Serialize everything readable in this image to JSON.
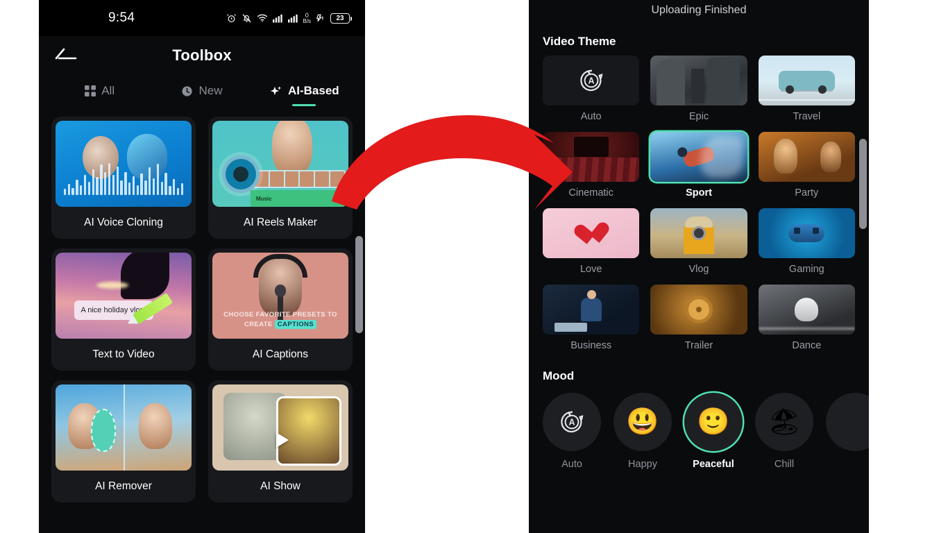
{
  "left_phone": {
    "status_bar": {
      "time": "9:54",
      "network_speed_value": "0",
      "network_speed_unit": "B/s",
      "battery_level": "23",
      "icons": [
        "alarm-icon",
        "bell-muted-icon",
        "wifi-icon",
        "signal-bars-icon",
        "signal-bars-2-icon",
        "network-speed-icon",
        "charging-icon",
        "battery-icon"
      ]
    },
    "header": {
      "title": "Toolbox",
      "back_icon": "back-arrow-icon"
    },
    "tabs": [
      {
        "label": "All",
        "icon": "grid-icon",
        "active": false
      },
      {
        "label": "New",
        "icon": "clock-icon",
        "active": false
      },
      {
        "label": "AI-Based",
        "icon": "sparkle-icon",
        "active": true
      }
    ],
    "tools": [
      {
        "name": "AI Voice Cloning",
        "thumb": "voice-cloning-thumb"
      },
      {
        "name": "AI Reels Maker",
        "thumb": "reels-maker-thumb",
        "overlay_label": "Music"
      },
      {
        "name": "Text to Video",
        "thumb": "text-to-video-thumb",
        "overlay_text": "A nice holiday vlog|"
      },
      {
        "name": "AI Captions",
        "thumb": "ai-captions-thumb",
        "overlay_line1": "CHOOSE  FAVORITE PRESETS TO",
        "overlay_line2": "CREATE ",
        "overlay_highlight": "CAPTIONS"
      },
      {
        "name": "AI Remover",
        "thumb": "ai-remover-thumb"
      },
      {
        "name": "AI Show",
        "thumb": "ai-show-thumb"
      }
    ]
  },
  "right_phone": {
    "upload_status": "Uploading Finished",
    "video_theme": {
      "title": "Video Theme",
      "items": [
        {
          "label": "Auto",
          "icon": "auto-circle-icon",
          "selected": false,
          "art": "auto"
        },
        {
          "label": "Epic",
          "icon": "epic-thumb",
          "selected": false,
          "art": "epic"
        },
        {
          "label": "Travel",
          "icon": "travel-thumb",
          "selected": false,
          "art": "travel"
        },
        {
          "label": "Cinematic",
          "icon": "cinematic-thumb",
          "selected": false,
          "art": "cine"
        },
        {
          "label": "Sport",
          "icon": "sport-thumb",
          "selected": true,
          "art": "sport"
        },
        {
          "label": "Party",
          "icon": "party-thumb",
          "selected": false,
          "art": "party"
        },
        {
          "label": "Love",
          "icon": "love-thumb",
          "selected": false,
          "art": "love"
        },
        {
          "label": "Vlog",
          "icon": "vlog-thumb",
          "selected": false,
          "art": "vlog"
        },
        {
          "label": "Gaming",
          "icon": "gaming-thumb",
          "selected": false,
          "art": "gaming"
        },
        {
          "label": "Business",
          "icon": "business-thumb",
          "selected": false,
          "art": "biz"
        },
        {
          "label": "Trailer",
          "icon": "trailer-thumb",
          "selected": false,
          "art": "trailer"
        },
        {
          "label": "Dance",
          "icon": "dance-thumb",
          "selected": false,
          "art": "dance"
        }
      ]
    },
    "mood": {
      "title": "Mood",
      "items": [
        {
          "label": "Auto",
          "emoji": "",
          "icon": "auto-circle-icon",
          "selected": false
        },
        {
          "label": "Happy",
          "emoji": "😃",
          "icon": "grinning-face-icon",
          "selected": false
        },
        {
          "label": "Peaceful",
          "emoji": "🙂",
          "icon": "slight-smile-icon",
          "selected": true
        },
        {
          "label": "Chill",
          "emoji": "🏖",
          "icon": "beach-umbrella-icon",
          "selected": false
        },
        {
          "label": "",
          "emoji": "",
          "icon": "partial-mood-icon",
          "selected": false
        }
      ]
    }
  },
  "annotation": {
    "arrow_icon": "red-curved-arrow-icon",
    "arrow_color": "#E31B1B"
  },
  "theme_colors": {
    "accent": "#4FE0B0",
    "panel_bg": "#0A0B0D",
    "card_bg": "#17191D",
    "text_primary": "#FFFFFF",
    "text_muted": "#8E9299"
  }
}
